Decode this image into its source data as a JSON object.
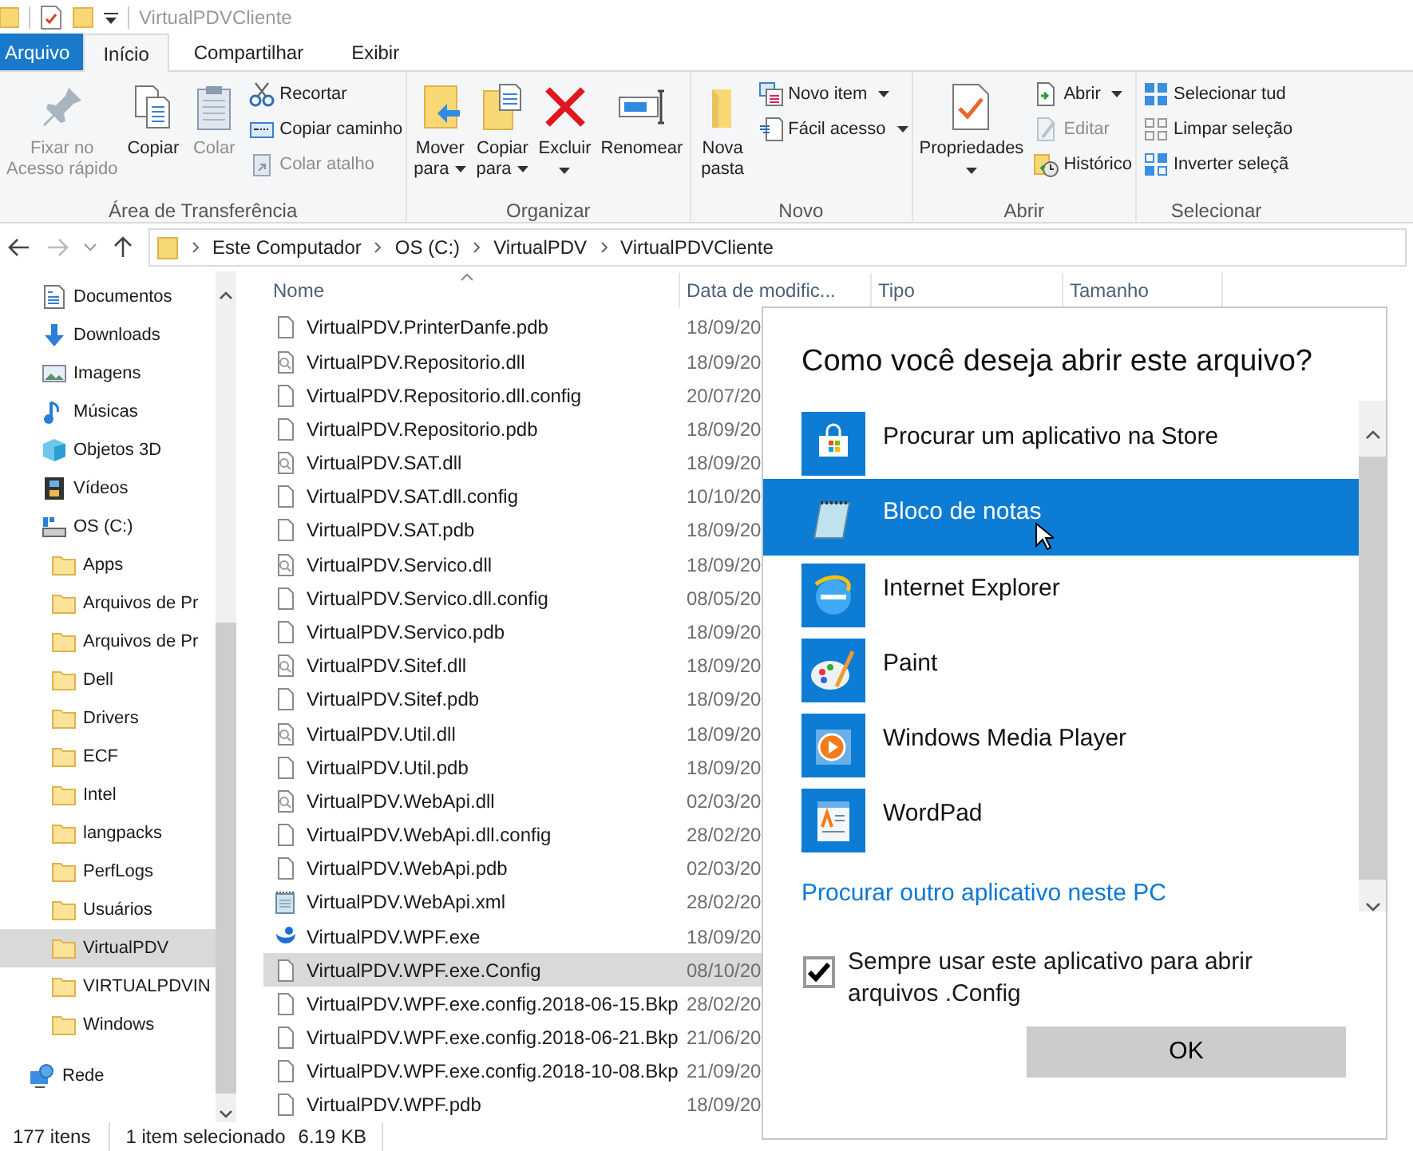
{
  "window": {
    "title": "VirtualPDVCliente"
  },
  "tabs": [
    {
      "label": "Arquivo",
      "kind": "file",
      "selected": false
    },
    {
      "label": "Início",
      "kind": "tab",
      "selected": true
    },
    {
      "label": "Compartilhar",
      "kind": "tab",
      "selected": false
    },
    {
      "label": "Exibir",
      "kind": "tab",
      "selected": false
    }
  ],
  "ribbon": [
    {
      "label": "Área de Transferência",
      "items": [
        {
          "kind": "large",
          "label": "Fixar no\nAcesso rápido",
          "disabled": true
        },
        {
          "kind": "large",
          "label": "Copiar",
          "disabled": false
        },
        {
          "kind": "large",
          "label": "Colar",
          "disabled": true
        },
        {
          "kind": "small",
          "label": "Recortar",
          "disabled": false
        },
        {
          "kind": "small",
          "label": "Copiar caminho",
          "disabled": false
        },
        {
          "kind": "small",
          "label": "Colar atalho",
          "disabled": true
        }
      ]
    },
    {
      "label": "Organizar",
      "items": [
        {
          "kind": "large",
          "label": "Mover\npara",
          "disabled": false,
          "dropdown": true
        },
        {
          "kind": "large",
          "label": "Copiar\npara",
          "disabled": false,
          "dropdown": true
        },
        {
          "kind": "large",
          "label": "Excluir",
          "disabled": false,
          "dropdown": true
        },
        {
          "kind": "large",
          "label": "Renomear",
          "disabled": false
        }
      ]
    },
    {
      "label": "Novo",
      "items": [
        {
          "kind": "large",
          "label": "Nova\npasta",
          "disabled": false
        },
        {
          "kind": "small",
          "label": "Novo item",
          "disabled": false,
          "dropdown": true
        },
        {
          "kind": "small",
          "label": "Fácil acesso",
          "disabled": false,
          "dropdown": true
        }
      ]
    },
    {
      "label": "Abrir",
      "items": [
        {
          "kind": "large",
          "label": "Propriedades",
          "disabled": false,
          "dropdown": true
        },
        {
          "kind": "small",
          "label": "Abrir",
          "disabled": false,
          "dropdown": true
        },
        {
          "kind": "small",
          "label": "Editar",
          "disabled": true
        },
        {
          "kind": "small",
          "label": "Histórico",
          "disabled": false
        }
      ]
    },
    {
      "label": "Selecionar",
      "items": [
        {
          "kind": "small",
          "label": "Selecionar tud",
          "disabled": false
        },
        {
          "kind": "small",
          "label": "Limpar seleção",
          "disabled": false
        },
        {
          "kind": "small",
          "label": "Inverter seleçã",
          "disabled": false
        }
      ]
    }
  ],
  "address": {
    "path": [
      "Este Computador",
      "OS (C:)",
      "VirtualPDV",
      "VirtualPDVCliente"
    ]
  },
  "nav": {
    "items": [
      {
        "label": "Documentos",
        "selected": false
      },
      {
        "label": "Downloads",
        "selected": false
      },
      {
        "label": "Imagens",
        "selected": false
      },
      {
        "label": "Músicas",
        "selected": false
      },
      {
        "label": "Objetos 3D",
        "selected": false
      },
      {
        "label": "Vídeos",
        "selected": false
      },
      {
        "label": "OS (C:)",
        "selected": false,
        "children": [
          {
            "label": "Apps",
            "selected": false
          },
          {
            "label": "Arquivos de Pr",
            "selected": false
          },
          {
            "label": "Arquivos de Pr",
            "selected": false
          },
          {
            "label": "Dell",
            "selected": false
          },
          {
            "label": "Drivers",
            "selected": false
          },
          {
            "label": "ECF",
            "selected": false
          },
          {
            "label": "Intel",
            "selected": false
          },
          {
            "label": "langpacks",
            "selected": false
          },
          {
            "label": "PerfLogs",
            "selected": false
          },
          {
            "label": "Usuários",
            "selected": false
          },
          {
            "label": "VirtualPDV",
            "selected": true
          },
          {
            "label": "VIRTUALPDVIN",
            "selected": false
          },
          {
            "label": "Windows",
            "selected": false
          }
        ]
      }
    ],
    "roots": [
      {
        "label": "Rede",
        "selected": false
      }
    ]
  },
  "columns": [
    "Nome",
    "Data de modific...",
    "Tipo",
    "Tamanho"
  ],
  "files": [
    {
      "name": "VirtualPDV.PrinterDanfe.pdb",
      "date": "18/09/20",
      "kind": "file",
      "selected": false
    },
    {
      "name": "VirtualPDV.Repositorio.dll",
      "date": "18/09/20",
      "kind": "library",
      "selected": false
    },
    {
      "name": "VirtualPDV.Repositorio.dll.config",
      "date": "20/07/20",
      "kind": "file",
      "selected": false
    },
    {
      "name": "VirtualPDV.Repositorio.pdb",
      "date": "18/09/20",
      "kind": "file",
      "selected": false
    },
    {
      "name": "VirtualPDV.SAT.dll",
      "date": "18/09/20",
      "kind": "library",
      "selected": false
    },
    {
      "name": "VirtualPDV.SAT.dll.config",
      "date": "10/10/20",
      "kind": "file",
      "selected": false
    },
    {
      "name": "VirtualPDV.SAT.pdb",
      "date": "18/09/20",
      "kind": "file",
      "selected": false
    },
    {
      "name": "VirtualPDV.Servico.dll",
      "date": "18/09/20",
      "kind": "library",
      "selected": false
    },
    {
      "name": "VirtualPDV.Servico.dll.config",
      "date": "08/05/20",
      "kind": "file",
      "selected": false
    },
    {
      "name": "VirtualPDV.Servico.pdb",
      "date": "18/09/20",
      "kind": "file",
      "selected": false
    },
    {
      "name": "VirtualPDV.Sitef.dll",
      "date": "18/09/20",
      "kind": "library",
      "selected": false
    },
    {
      "name": "VirtualPDV.Sitef.pdb",
      "date": "18/09/20",
      "kind": "file",
      "selected": false
    },
    {
      "name": "VirtualPDV.Util.dll",
      "date": "18/09/20",
      "kind": "library",
      "selected": false
    },
    {
      "name": "VirtualPDV.Util.pdb",
      "date": "18/09/20",
      "kind": "file",
      "selected": false
    },
    {
      "name": "VirtualPDV.WebApi.dll",
      "date": "02/03/20",
      "kind": "library",
      "selected": false
    },
    {
      "name": "VirtualPDV.WebApi.dll.config",
      "date": "28/02/20",
      "kind": "file",
      "selected": false
    },
    {
      "name": "VirtualPDV.WebApi.pdb",
      "date": "02/03/20",
      "kind": "file",
      "selected": false
    },
    {
      "name": "VirtualPDV.WebApi.xml",
      "date": "28/02/20",
      "kind": "notes",
      "selected": false
    },
    {
      "name": "VirtualPDV.WPF.exe",
      "date": "18/09/20",
      "kind": "app",
      "selected": false
    },
    {
      "name": "VirtualPDV.WPF.exe.Config",
      "date": "08/10/20",
      "kind": "file",
      "selected": true
    },
    {
      "name": "VirtualPDV.WPF.exe.config.2018-06-15.Bkp",
      "date": "28/02/20",
      "kind": "file",
      "selected": false
    },
    {
      "name": "VirtualPDV.WPF.exe.config.2018-06-21.Bkp",
      "date": "21/06/20",
      "kind": "file",
      "selected": false
    },
    {
      "name": "VirtualPDV.WPF.exe.config.2018-10-08.Bkp",
      "date": "21/09/20",
      "kind": "file",
      "selected": false
    },
    {
      "name": "VirtualPDV.WPF.pdb",
      "date": "18/09/20",
      "kind": "file",
      "selected": false
    }
  ],
  "status_bar": [
    "177 itens",
    "1 item selecionado",
    "6.19 KB"
  ],
  "dialog": {
    "title": "Como você deseja abrir este arquivo?",
    "apps": [
      {
        "name": "Procurar um aplicativo na Store",
        "kind": "store",
        "selected": false
      },
      {
        "name": "Bloco de notas",
        "kind": "notepad",
        "selected": true
      },
      {
        "name": "Internet Explorer",
        "kind": "browser",
        "selected": false
      },
      {
        "name": "Paint",
        "kind": "paint",
        "selected": false
      },
      {
        "name": "Windows Media Player",
        "kind": "player",
        "selected": false
      },
      {
        "name": "WordPad",
        "kind": "wordpad",
        "selected": false
      }
    ],
    "link": "Procurar outro aplicativo neste PC",
    "checkbox": {
      "label": "Sempre usar este aplicativo para abrir arquivos .Config",
      "checked": true
    },
    "button": "OK"
  }
}
